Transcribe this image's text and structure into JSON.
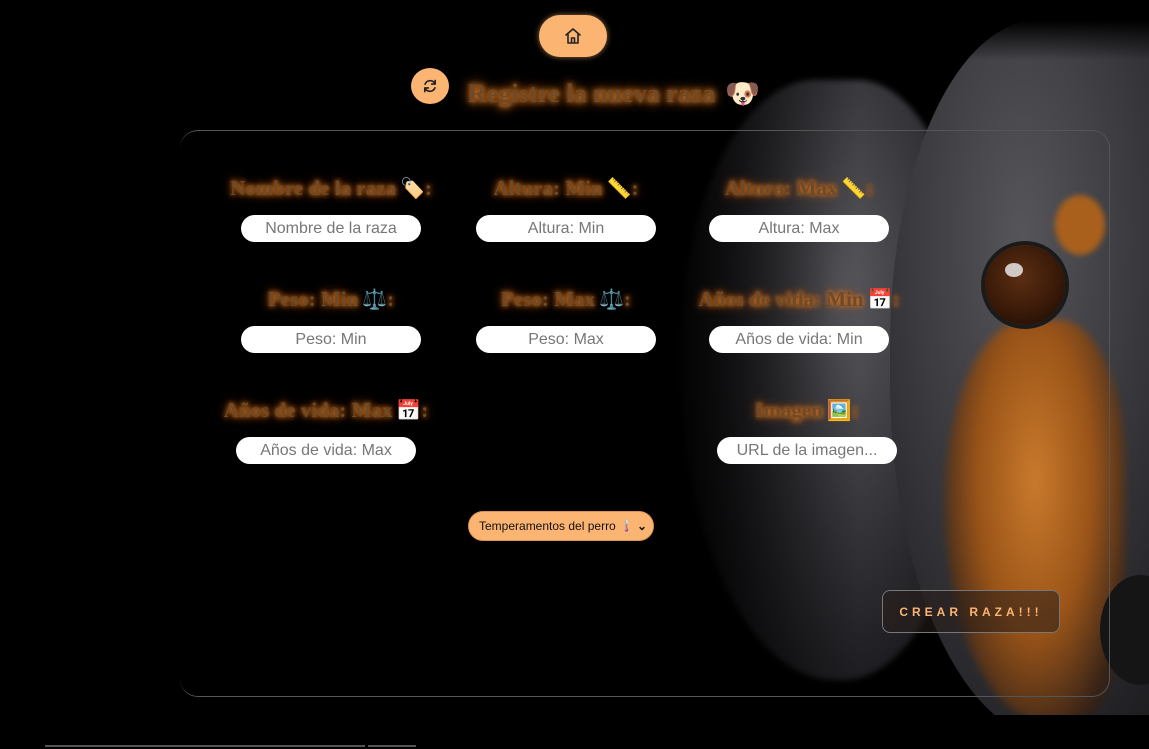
{
  "header": {
    "title": "Registre la nueva raza",
    "title_emoji": "🐶"
  },
  "fields": [
    {
      "label": "Nombre de la raza",
      "emoji": "🏷️",
      "placeholder": "Nombre de la raza"
    },
    {
      "label": "Altura: Min",
      "emoji": "📏",
      "placeholder": "Altura: Min"
    },
    {
      "label": "Altura: Max",
      "emoji": "📏",
      "placeholder": "Altura: Max"
    },
    {
      "label": "Peso: Min",
      "emoji": "⚖️",
      "placeholder": "Peso: Min"
    },
    {
      "label": "Peso: Max",
      "emoji": "⚖️",
      "placeholder": "Peso: Max"
    },
    {
      "label": "Años de vida: Min",
      "emoji": "📅",
      "placeholder": "Años de vida: Min"
    },
    {
      "label": "Años de vida: Max",
      "emoji": "📅",
      "placeholder": "Años de vida: Max"
    },
    {
      "label": "Imagen",
      "emoji": "🖼️",
      "placeholder": "URL de la imagen..."
    }
  ],
  "label_suffix": ":",
  "temperament_select": {
    "selected": "Temperamentos del perro 🌡️"
  },
  "create_button": {
    "label": "CREAR RAZA!!!"
  },
  "icons": {
    "home": "home-icon",
    "refresh": "refresh-icon"
  },
  "colors": {
    "accent": "#fcb472",
    "glow": "#e07a1f",
    "label_text": "#6e4a28",
    "background": "#000000"
  }
}
